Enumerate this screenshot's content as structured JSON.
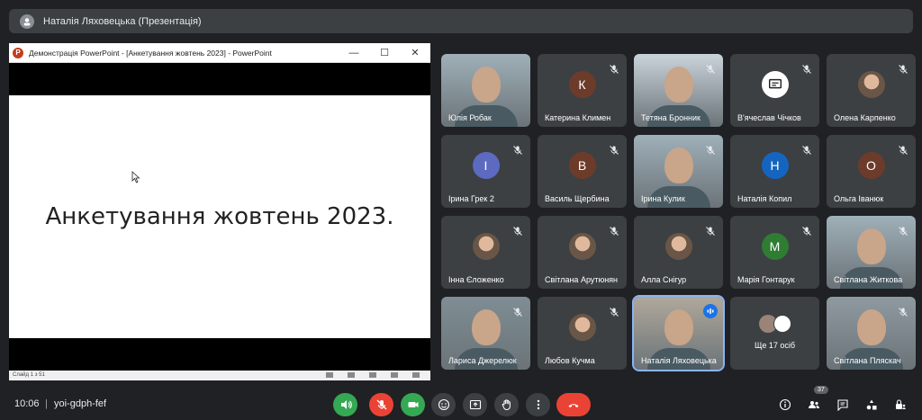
{
  "presenter_bar": {
    "title": "Наталія Ляховецька (Презентація)"
  },
  "presentation": {
    "window_title": "Демонстрація PowerPoint - [Анкетування жовтень 2023] - PowerPoint",
    "app_icon_letter": "P",
    "slide_text": "Анкетування жовтень 2023.",
    "status_text": "Слайд 1 з 51"
  },
  "participants": [
    {
      "name": "Юлія Робак",
      "type": "video"
    },
    {
      "name": "Катерина Климен",
      "type": "initial",
      "initial": "К",
      "color": "#6d3b2a",
      "muted": true
    },
    {
      "name": "Тетяна Бронник",
      "type": "video",
      "muted": true
    },
    {
      "name": "В'ячеслав Чічков",
      "type": "icon",
      "muted": true
    },
    {
      "name": "Олена Карпенко",
      "type": "photo",
      "muted": true
    },
    {
      "name": "Ірина Грек 2",
      "type": "initial",
      "initial": "І",
      "color": "#5c6bc0",
      "muted": true
    },
    {
      "name": "Василь Щербина",
      "type": "initial",
      "initial": "В",
      "color": "#6d3b2a",
      "muted": true
    },
    {
      "name": "Ірина Кулик",
      "type": "video",
      "muted": true
    },
    {
      "name": "Наталія Копил",
      "type": "initial",
      "initial": "Н",
      "color": "#1565c0",
      "muted": true
    },
    {
      "name": "Ольга Іванюк",
      "type": "initial",
      "initial": "О",
      "color": "#6d3b2a",
      "muted": true
    },
    {
      "name": "Інна Єложенко",
      "type": "photo",
      "muted": true
    },
    {
      "name": "Світлана Арутюнян",
      "type": "photo",
      "muted": true
    },
    {
      "name": "Алла Снігур",
      "type": "photo",
      "muted": true
    },
    {
      "name": "Марія Гонтарук",
      "type": "initial",
      "initial": "М",
      "color": "#2e7d32",
      "muted": true
    },
    {
      "name": "Світлана Житкова",
      "type": "video",
      "muted": true
    },
    {
      "name": "Лариса Джерелюк",
      "type": "video",
      "muted": true
    },
    {
      "name": "Любов Кучма",
      "type": "photo",
      "muted": true
    },
    {
      "name": "Наталія Ляховецька",
      "type": "video",
      "speaking": true
    },
    {
      "name": "Ще 17 осіб",
      "type": "more"
    },
    {
      "name": "Світлана Пляскач",
      "type": "video",
      "muted": true
    }
  ],
  "bottom_bar": {
    "time": "10:06",
    "separator": "|",
    "meeting_code": "yoi-gdph-fef",
    "participants_count": "37"
  },
  "colors": {
    "background": "#202124",
    "tile": "#3c4043",
    "mic_green": "#34a853",
    "mic_red": "#ea4335",
    "end_red": "#ea4335",
    "accent": "#8ab4f8"
  }
}
